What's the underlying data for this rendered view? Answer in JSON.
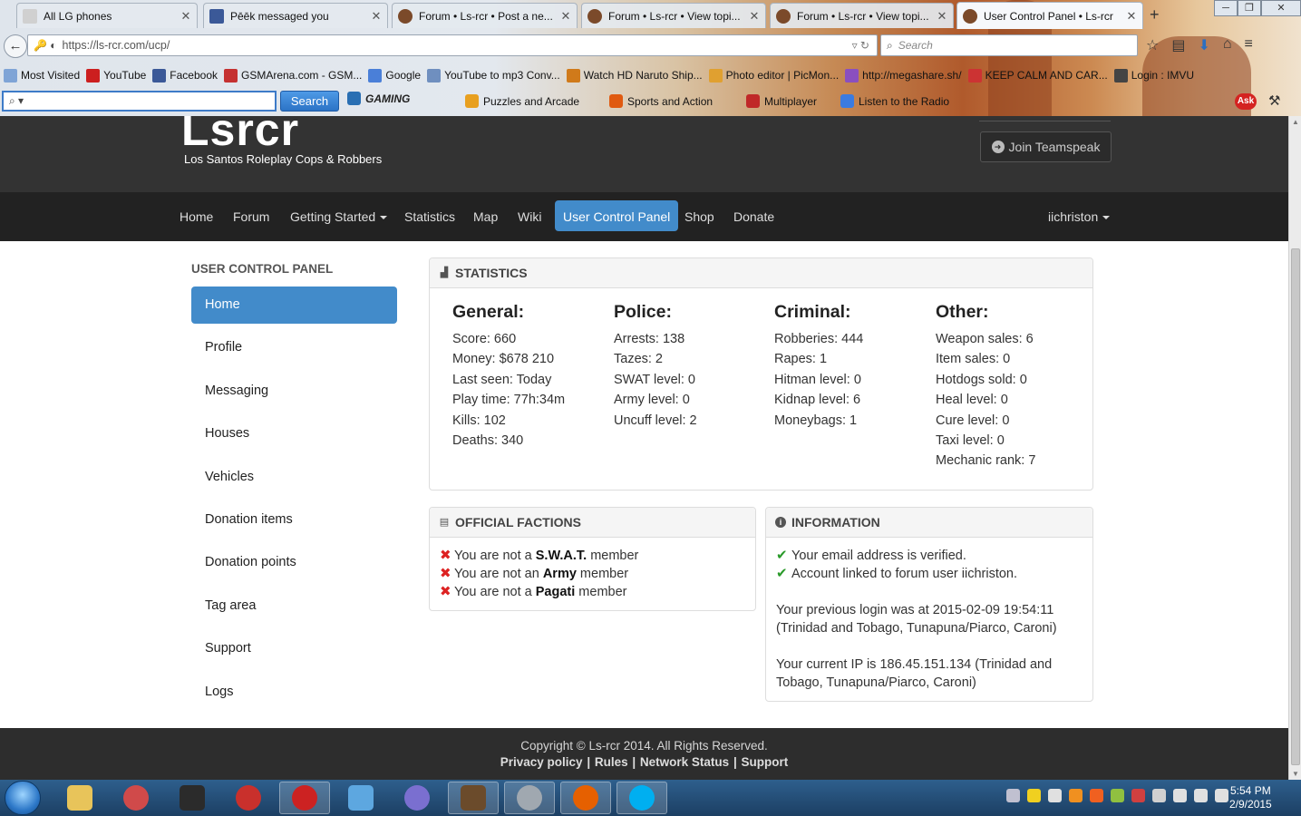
{
  "browser": {
    "tabs": [
      {
        "title": "All LG phones",
        "icon_color": "#d0d0d0"
      },
      {
        "title": "Pēēk messaged you",
        "icon_color": "#3b5998"
      },
      {
        "title": "Forum • Ls-rcr • Post a ne...",
        "icon_color": "#7b4a2a"
      },
      {
        "title": "Forum • Ls-rcr • View topi...",
        "icon_color": "#7b4a2a"
      },
      {
        "title": "Forum • Ls-rcr • View topi...",
        "icon_color": "#7b4a2a"
      },
      {
        "title": "User Control Panel • Ls-rcr",
        "icon_color": "#7b4a2a"
      }
    ],
    "url": "https://ls-rcr.com/ucp/",
    "search_placeholder": "Search",
    "bookmarks": [
      {
        "label": "Most Visited",
        "icon_color": "#7fa4d6"
      },
      {
        "label": "YouTube",
        "icon_color": "#cc1f1f"
      },
      {
        "label": "Facebook",
        "icon_color": "#3b5998"
      },
      {
        "label": "GSMArena.com - GSM...",
        "icon_color": "#c53131"
      },
      {
        "label": "Google",
        "icon_color": "#4a7fd8"
      },
      {
        "label": "YouTube to mp3 Conv...",
        "icon_color": "#6f8fbf"
      },
      {
        "label": "Watch HD Naruto Ship...",
        "icon_color": "#d07a1a"
      },
      {
        "label": "Photo editor | PicMon...",
        "icon_color": "#e0a030"
      },
      {
        "label": "http://megashare.sh/",
        "icon_color": "#8a4fbf"
      },
      {
        "label": "KEEP CALM AND CAR...",
        "icon_color": "#cc3333"
      },
      {
        "label": "Login : IMVU",
        "icon_color": "#444444"
      }
    ],
    "ask_toolbar": {
      "search_button": "Search",
      "items": [
        "GAMING",
        "Puzzles and Arcade",
        "Sports and Action",
        "Multiplayer",
        "Listen to the Radio"
      ],
      "badge": "Ask"
    }
  },
  "site": {
    "logo": "Lsrcr",
    "tagline": "Los Santos Roleplay Cops & Robbers",
    "teamspeak_button": "Join Teamspeak",
    "nav": [
      "Home",
      "Forum",
      "Getting Started",
      "Statistics",
      "Map",
      "Wiki",
      "User Control Panel",
      "Shop",
      "Donate"
    ],
    "active_nav": "User Control Panel",
    "user": "iichriston"
  },
  "sidebar": {
    "title": "USER CONTROL PANEL",
    "items": [
      "Home",
      "Profile",
      "Messaging",
      "Houses",
      "Vehicles",
      "Donation items",
      "Donation points",
      "Tag area",
      "Support",
      "Logs"
    ],
    "active": "Home"
  },
  "statistics": {
    "title": "STATISTICS",
    "columns": [
      {
        "heading": "General:",
        "rows": [
          "Score: 660",
          "Money: $678 210",
          "Last seen: Today",
          "Play time: 77h:34m",
          "Kills: 102",
          "Deaths: 340"
        ]
      },
      {
        "heading": "Police:",
        "rows": [
          "Arrests: 138",
          "Tazes: 2",
          "SWAT level: 0",
          "Army level: 0",
          "Uncuff level: 2"
        ]
      },
      {
        "heading": "Criminal:",
        "rows": [
          "Robberies: 444",
          "Rapes: 1",
          "Hitman level: 0",
          "Kidnap level: 6",
          "Moneybags: 1"
        ]
      },
      {
        "heading": "Other:",
        "rows": [
          "Weapon sales: 6",
          "Item sales: 0",
          "Hotdogs sold: 0",
          "Heal level: 0",
          "Cure level: 0",
          "Taxi level: 0",
          "Mechanic rank: 7"
        ]
      }
    ]
  },
  "factions": {
    "title": "OFFICIAL FACTIONS",
    "items": [
      {
        "pre": "You are not a ",
        "name": "S.W.A.T.",
        "post": " member"
      },
      {
        "pre": "You are not an ",
        "name": "Army",
        "post": " member"
      },
      {
        "pre": "You are not a ",
        "name": "Pagati",
        "post": " member"
      }
    ]
  },
  "information": {
    "title": "INFORMATION",
    "checks": [
      "Your email address is verified.",
      "Account linked to forum user iichriston."
    ],
    "previous_login": "Your previous login was at 2015-02-09 19:54:11 (Trinidad and Tobago, Tunapuna/Piarco, Caroni)",
    "current_ip": "Your current IP is 186.45.151.134 (Trinidad and Tobago, Tunapuna/Piarco, Caroni)"
  },
  "footer": {
    "copyright": "Copyright © Ls-rcr 2014. All Rights Reserved.",
    "links": [
      "Privacy policy",
      "Rules",
      "Network Status",
      "Support"
    ]
  },
  "taskbar": {
    "time": "5:54 PM",
    "date": "2/9/2015",
    "apps": [
      {
        "name": "explorer",
        "color": "#e8c45a"
      },
      {
        "name": "snipping",
        "color": "#d04a4a"
      },
      {
        "name": "imvu",
        "color": "#2b2b2b"
      },
      {
        "name": "downloader",
        "color": "#c9302c"
      },
      {
        "name": "gta-sa-mp",
        "color": "#cc2222"
      },
      {
        "name": "notepad",
        "color": "#5da7e0"
      },
      {
        "name": "browser-tool",
        "color": "#7a6fd0"
      },
      {
        "name": "gta-launcher",
        "color": "#6b4b2b"
      },
      {
        "name": "speaker-app",
        "color": "#a0a8b0"
      },
      {
        "name": "firefox",
        "color": "#e66000"
      },
      {
        "name": "skype",
        "color": "#00aff0"
      }
    ]
  }
}
